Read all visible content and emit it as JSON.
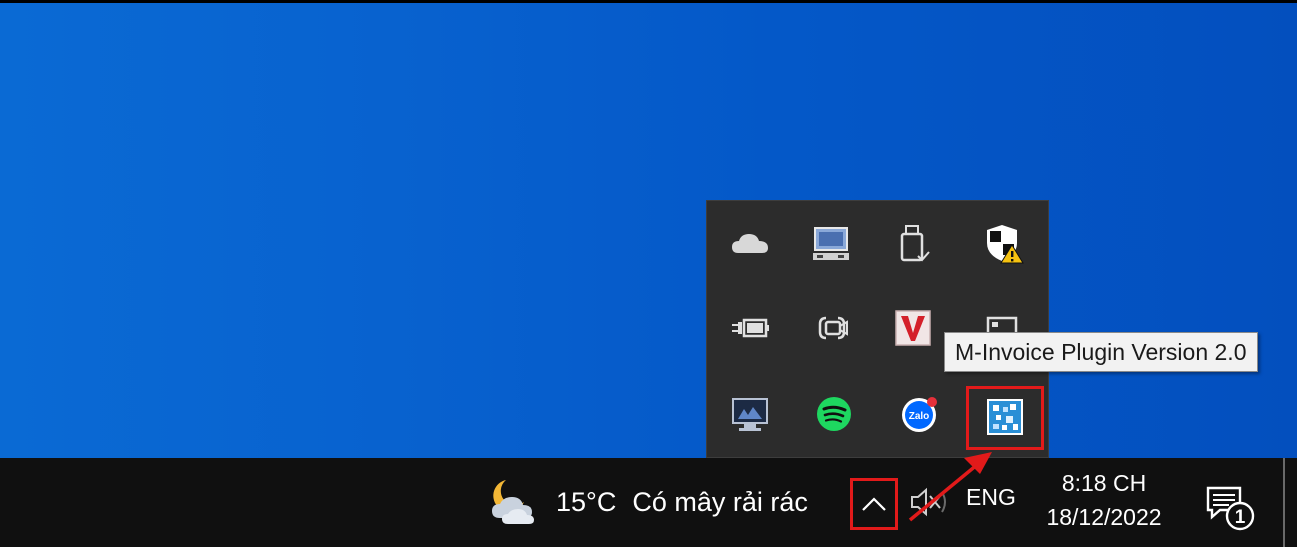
{
  "taskbar": {
    "weather": {
      "icon": "partly-cloudy-night-icon",
      "temperature": "15°C",
      "condition": "Có mây rải rác"
    },
    "show_hidden_icon": "chevron-up-icon",
    "volume_icon": "speaker-muted-icon",
    "language": "ENG",
    "clock": {
      "time": "8:18 CH",
      "date": "18/12/2022"
    },
    "notifications": {
      "icon": "action-center-icon",
      "count": "1"
    }
  },
  "tray_flyout": {
    "icons": [
      "onedrive-cloud-icon",
      "network-monitor-icon",
      "usb-safely-remove-icon",
      "windows-security-warning-icon",
      "battery-power-icon",
      "camera-icon",
      "v-antivirus-icon",
      "card-reader-icon",
      "display-monitor-icon",
      "spotify-icon",
      "zalo-icon",
      "m-invoice-plugin-icon"
    ],
    "zalo_label": "Zalo",
    "tooltip": "M-Invoice Plugin Version 2.0"
  },
  "colors": {
    "desktop_blue": "#0862cf",
    "taskbar": "#101010",
    "flyout": "#2c2c2c",
    "highlight_red": "#e21a1a",
    "spotify_green": "#1ed760",
    "zalo_blue": "#0068ff"
  }
}
